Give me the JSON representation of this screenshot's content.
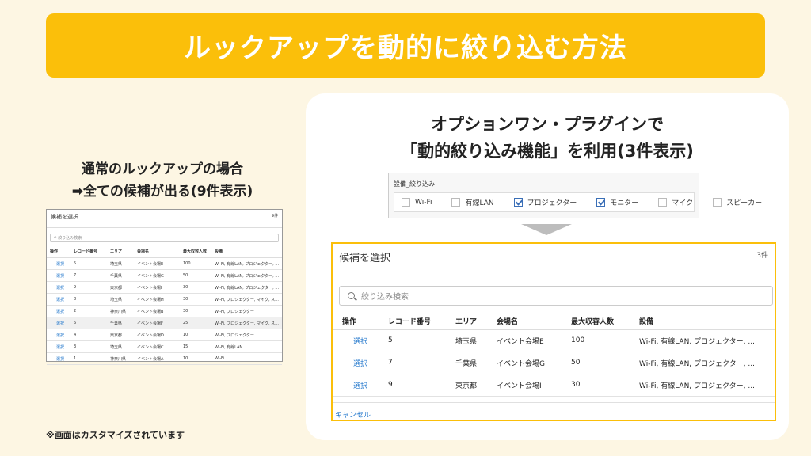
{
  "banner_title": "ルックアップを動的に絞り込む方法",
  "left_caption": {
    "line1": "通常のルックアップの場合",
    "line2": "➡全ての候補が出る(9件表示)"
  },
  "small_dialog": {
    "title": "候補を選択",
    "count": "9件",
    "search_placeholder": "絞り込み検索",
    "columns": [
      "操作",
      "レコード番号",
      "エリア",
      "会場名",
      "最大収容人数",
      "設備"
    ],
    "rows": [
      [
        "選択",
        "5",
        "埼玉県",
        "イベント会場E",
        "100",
        "Wi-Fi, 有線LAN, プロジェクター, ..."
      ],
      [
        "選択",
        "7",
        "千葉県",
        "イベント会場G",
        "50",
        "Wi-Fi, 有線LAN, プロジェクター, ..."
      ],
      [
        "選択",
        "9",
        "東京都",
        "イベント会場I",
        "30",
        "Wi-Fi, 有線LAN, プロジェクター, ..."
      ],
      [
        "選択",
        "8",
        "埼玉県",
        "イベント会場H",
        "30",
        "Wi-Fi, プロジェクター, マイク, ス..."
      ],
      [
        "選択",
        "2",
        "神奈川県",
        "イベント会場B",
        "30",
        "Wi-Fi, プロジェクター"
      ],
      [
        "選択",
        "6",
        "千葉県",
        "イベント会場F",
        "25",
        "Wi-Fi, プロジェクター, マイク, ス..."
      ],
      [
        "選択",
        "4",
        "東京都",
        "イベント会場D",
        "10",
        "Wi-Fi, プロジェクター"
      ],
      [
        "選択",
        "3",
        "埼玉県",
        "イベント会場C",
        "15",
        "Wi-Fi, 有線LAN"
      ],
      [
        "選択",
        "1",
        "神奈川県",
        "イベント会場A",
        "10",
        "Wi-Fi"
      ]
    ]
  },
  "note": "※画面はカスタマイズされています",
  "right_caption": {
    "line1": "オプションワン・プラグインで",
    "line2": "「動的絞り込み機能」を利用(3件表示)"
  },
  "filter": {
    "title": "設備_絞り込み",
    "options": [
      {
        "label": "Wi-Fi",
        "checked": false
      },
      {
        "label": "有線LAN",
        "checked": false
      },
      {
        "label": "プロジェクター",
        "checked": true
      },
      {
        "label": "モニター",
        "checked": true
      },
      {
        "label": "マイク",
        "checked": false
      },
      {
        "label": "スピーカー",
        "checked": false
      }
    ]
  },
  "dialog": {
    "title": "候補を選択",
    "count": "3件",
    "search_placeholder": "絞り込み検索",
    "columns": [
      "操作",
      "レコード番号",
      "エリア",
      "会場名",
      "最大収容人数",
      "設備"
    ],
    "rows": [
      [
        "選択",
        "5",
        "埼玉県",
        "イベント会場E",
        "100",
        "Wi-Fi, 有線LAN, プロジェクター, ..."
      ],
      [
        "選択",
        "7",
        "千葉県",
        "イベント会場G",
        "50",
        "Wi-Fi, 有線LAN, プロジェクター, ..."
      ],
      [
        "選択",
        "9",
        "東京都",
        "イベント会場I",
        "30",
        "Wi-Fi, 有線LAN, プロジェクター, ..."
      ]
    ],
    "cancel_label": "キャンセル"
  },
  "colors": {
    "accent": "#fbbf0a",
    "link": "#2277cc",
    "background": "#fdf6e3"
  },
  "icons": {
    "search": "search-icon",
    "arrow": "arrow-down-icon"
  }
}
